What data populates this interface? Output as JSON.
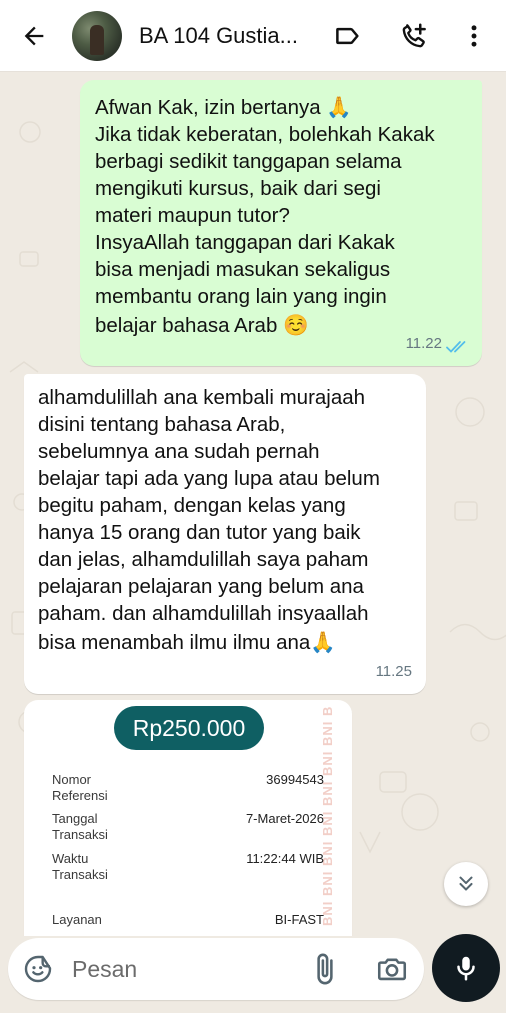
{
  "header": {
    "contact_name": "BA 104 Gustia...",
    "icons": [
      "back-arrow-icon",
      "label-icon",
      "add-call-icon",
      "more-vert-icon"
    ]
  },
  "messages": {
    "outgoing": {
      "lines": [
        "Afwan Kak, izin bertanya 🙏",
        "Jika tidak keberatan, bolehkah Kakak",
        "berbagi sedikit tanggapan selama",
        "mengikuti kursus, baik dari segi",
        "materi maupun tutor?",
        "InsyaAllah tanggapan dari Kakak",
        "bisa menjadi masukan sekaligus",
        "membantu orang lain yang ingin",
        "belajar bahasa Arab ☺️"
      ],
      "time": "11.22",
      "status": "read"
    },
    "incoming": {
      "lines": [
        "alhamdulillah ana kembali murajaah",
        "disini tentang bahasa Arab,",
        "sebelumnya ana sudah pernah",
        "belajar tapi ada yang lupa atau belum",
        "begitu paham, dengan kelas yang",
        "hanya 15 orang dan tutor yang baik",
        "dan jelas, alhamdulillah saya paham",
        "pelajaran pelajaran yang belum ana",
        "paham. dan alhamdulillah insyaallah",
        "bisa menambah ilmu ilmu ana🙏"
      ],
      "time": "11.25"
    },
    "receipt": {
      "amount": "Rp250.000",
      "rows": [
        {
          "label_1": "Nomor",
          "label_2": "Referensi",
          "value": "36994543"
        },
        {
          "label_1": "Tanggal",
          "label_2": "Transaksi",
          "value": "7-Maret-2026"
        },
        {
          "label_1": "Waktu",
          "label_2": "Transaksi",
          "value": "11:22:44 WIB"
        },
        {
          "label_1": "Layanan",
          "label_2": "",
          "value": "BI-FAST"
        }
      ],
      "watermark": "BNI BNI BNI BNI BNI BNI BNI BNI"
    }
  },
  "composer": {
    "placeholder": "Pesan"
  },
  "colors": {
    "outgoing_bubble": "#d9fdd3",
    "incoming_bubble": "#ffffff",
    "chat_background": "#efeae2",
    "read_ticks": "#53bdeb",
    "receipt_pill": "#0f5f63",
    "mic_button": "#111b21"
  }
}
